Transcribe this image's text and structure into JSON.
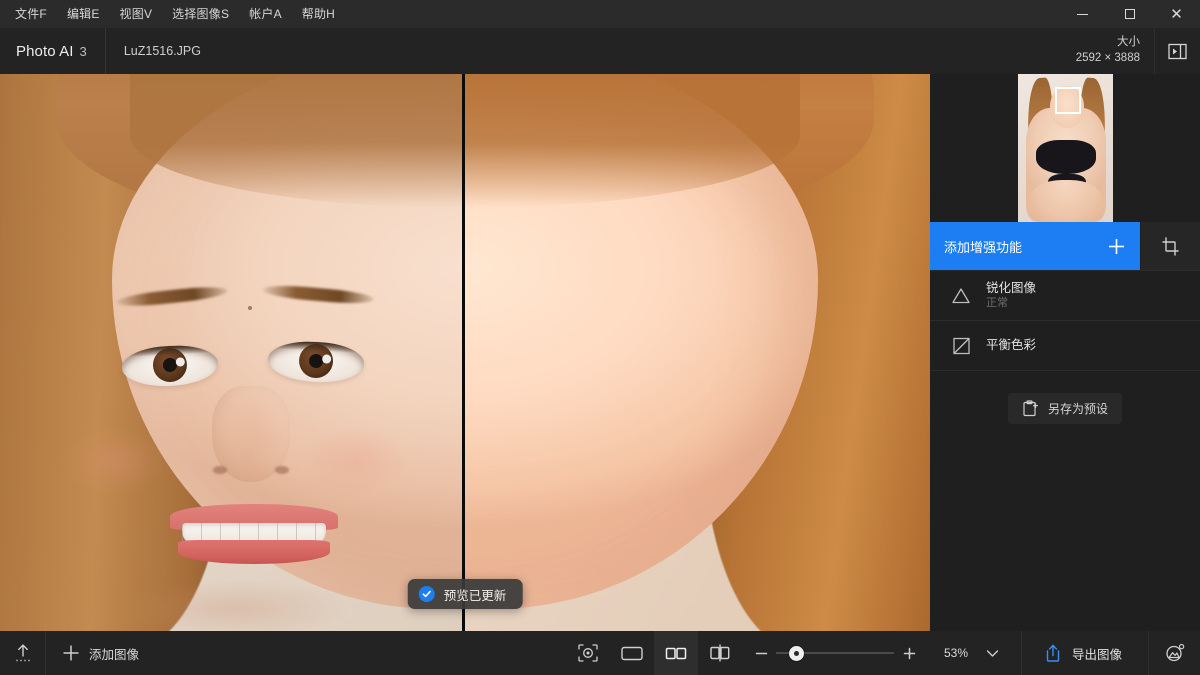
{
  "window": {
    "menu_items": [
      {
        "label": "文件F"
      },
      {
        "label": "编辑E"
      },
      {
        "label": "视图V"
      },
      {
        "label": "选择图像S"
      },
      {
        "label": "帐户A"
      },
      {
        "label": "帮助H"
      }
    ],
    "controls": {
      "minimize": "−",
      "maximize": "▢",
      "close": "✕"
    }
  },
  "header": {
    "app_name": "Photo AI",
    "app_version": "3",
    "file_tab": "LuZ1516.JPG",
    "size_label": "大小",
    "size_value": "2592 × 3888",
    "panel_toggle_icon": "panel-collapse-icon"
  },
  "canvas": {
    "view_mode": "split-before-after",
    "toast": {
      "icon": "check-circle-icon",
      "text": "预览已更新"
    }
  },
  "right_panel": {
    "thumbnail": {
      "face_box_visible": true
    },
    "add_enhancement": {
      "label": "添加增强功能",
      "plus_icon": "plus-icon",
      "accent_color": "#1c7ef2"
    },
    "crop_icon": "crop-icon",
    "enhancements": [
      {
        "icon": "sharpen-triangle-icon",
        "name": "锐化图像",
        "sub": "正常"
      },
      {
        "icon": "balance-color-icon",
        "name": "平衡色彩",
        "sub": ""
      }
    ],
    "save_preset": {
      "icon": "save-preset-icon",
      "label": "另存为预设"
    }
  },
  "bottom_bar": {
    "import_icon": "import-upload-icon",
    "add_image": {
      "icon": "plus-icon",
      "label": "添加图像"
    },
    "view_tools": [
      {
        "icon": "face-detect-icon",
        "name": "face-detect",
        "active": false
      },
      {
        "icon": "single-view-icon",
        "name": "single-view",
        "active": false
      },
      {
        "icon": "split-view-icon",
        "name": "split-view",
        "active": true
      },
      {
        "icon": "compare-slider-icon",
        "name": "compare-slider",
        "active": false
      }
    ],
    "zoom": {
      "minus": "−",
      "plus": "+",
      "value": "53%",
      "chevron_icon": "chevron-down-icon",
      "slider_percent": 12
    },
    "export": {
      "icon": "share-export-icon",
      "label": "导出图像",
      "accent_color": "#3b8ef0"
    },
    "image_settings_icon": "image-settings-icon"
  }
}
